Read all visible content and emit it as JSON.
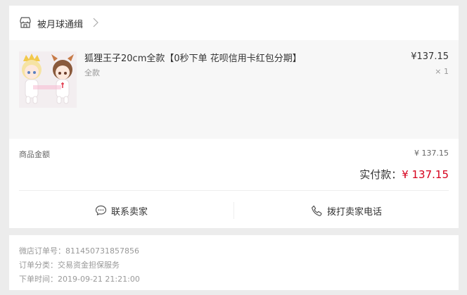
{
  "shop": {
    "name": "被月球通缉",
    "icon": "shop-icon",
    "chevron_icon": "chevron-right-icon"
  },
  "product": {
    "title": "狐狸王子20cm全款【0秒下单 花呗信用卡红包分期】",
    "sku": "全款",
    "price": "¥137.15",
    "quantity": "× 1"
  },
  "summary": {
    "goods_amount_label": "商品金额",
    "goods_amount_value": "¥ 137.15",
    "paid_label": "实付款：",
    "paid_value": "¥ 137.15",
    "paid_color": "#d6001c"
  },
  "actions": {
    "contact_label": "联系卖家",
    "contact_icon": "chat-bubble-icon",
    "call_label": "拨打卖家电话",
    "call_icon": "phone-icon"
  },
  "order_info": {
    "order_no_label": "微店订单号：",
    "order_no_value": "811450731857856",
    "category_label": "订单分类：",
    "category_value": "交易资金担保服务",
    "time_label": "下单时间：",
    "time_value": "2019-09-21 21:21:00"
  }
}
